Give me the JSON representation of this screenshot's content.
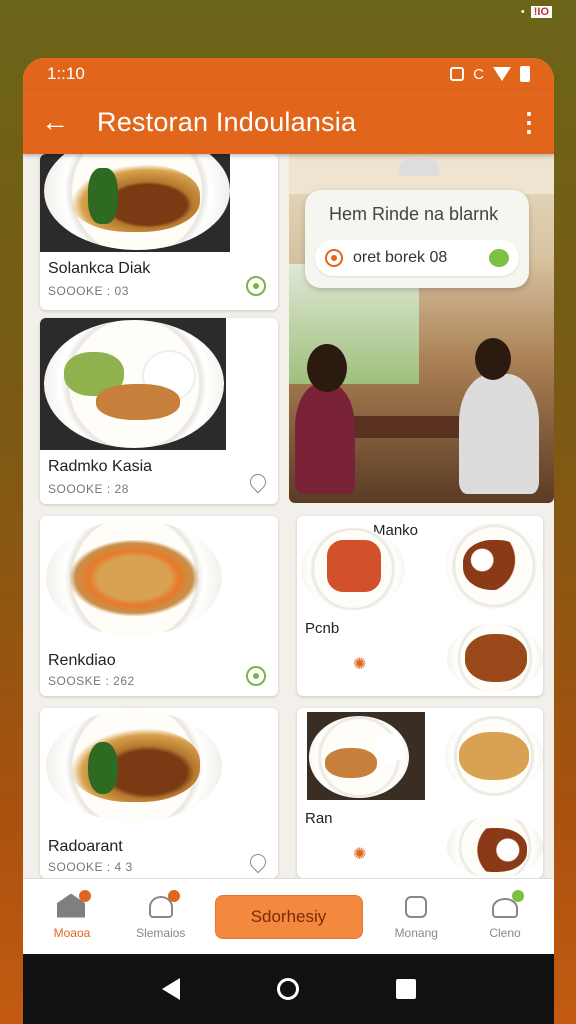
{
  "status": {
    "time": "1::10"
  },
  "outer_status": {
    "badge": "!IO"
  },
  "app_bar": {
    "title": "Restoran Indoulansia"
  },
  "cards": [
    {
      "title": "Solankca Diak",
      "sub": "SOOOKE : 03"
    },
    {
      "title": "Radmko Kasia",
      "sub": "SOOOKE : 28"
    },
    {
      "title": "Renkdiao",
      "sub": "SOOSKE : 262"
    },
    {
      "title": "Radoarant",
      "sub": "SOOOKE : 4 3"
    }
  ],
  "bubble": {
    "title": "Hem Rinde na blarnk",
    "row_text": "oret borek 08"
  },
  "right_cards": [
    {
      "top_label": "Manko",
      "title": "Pcnb"
    },
    {
      "title": "Ran"
    }
  ],
  "nav": {
    "items": [
      {
        "label": "Moaoa",
        "icon": "home-icon"
      },
      {
        "label": "Slemaios",
        "icon": "chef-icon"
      },
      {
        "label": "Monang",
        "icon": "pot-icon"
      },
      {
        "label": "Cleno",
        "icon": "people-icon"
      }
    ],
    "button_label": "Sdorhesiy"
  },
  "colors": {
    "accent": "#e1661b",
    "green": "#7cc242"
  }
}
